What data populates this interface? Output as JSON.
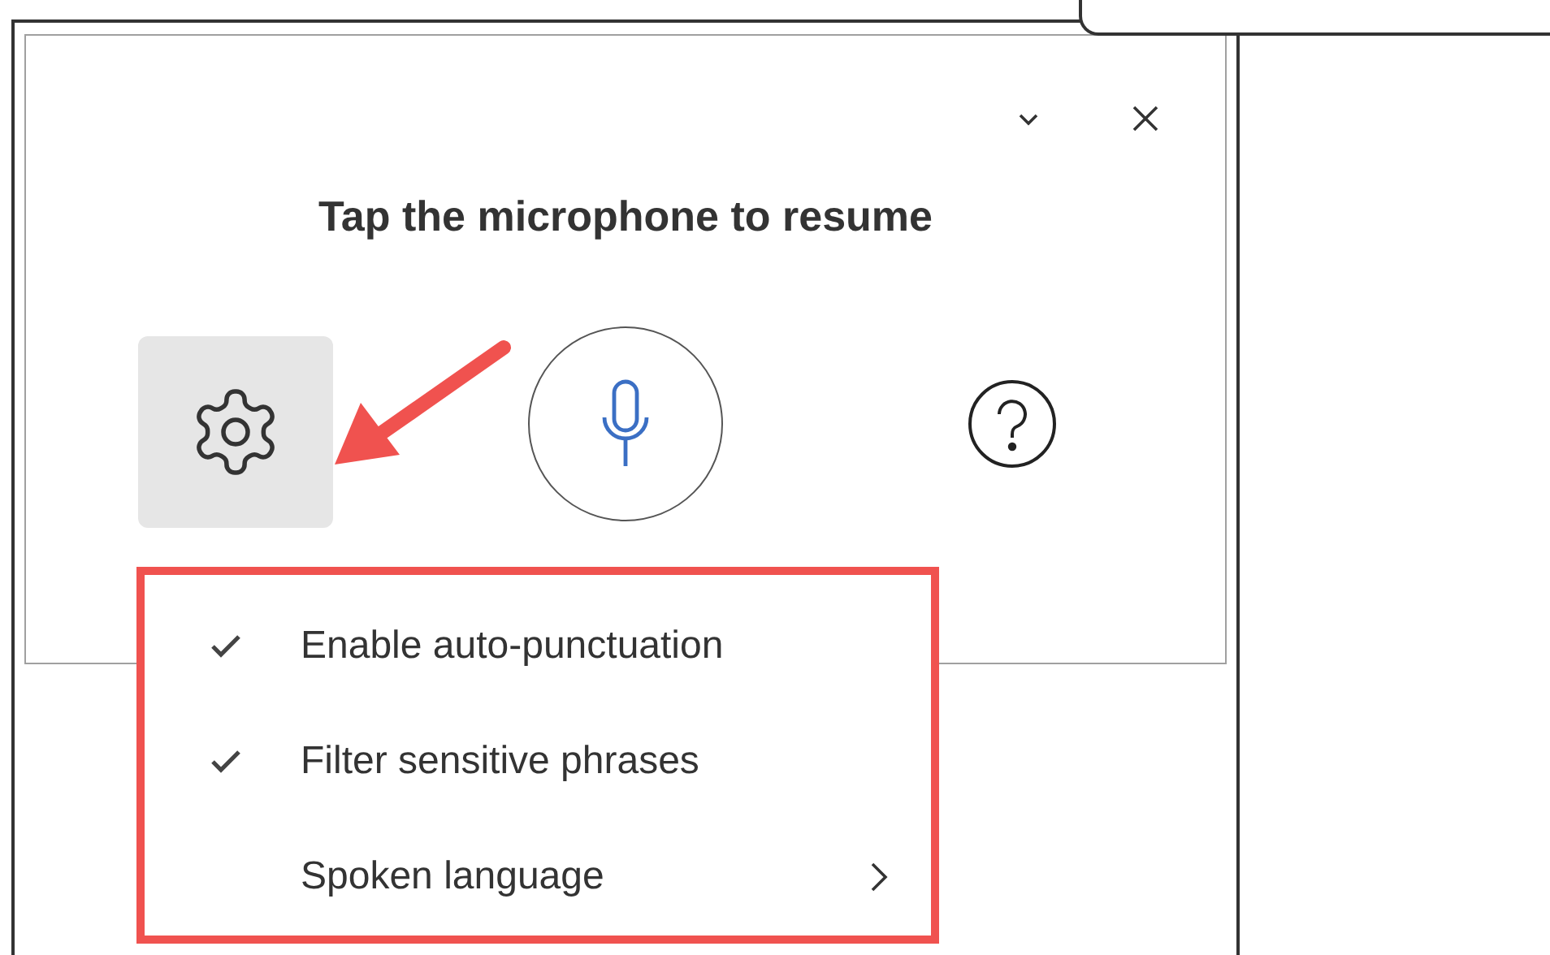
{
  "dictation_panel": {
    "title": "Tap the microphone to resume",
    "settings_button": {
      "active": true
    }
  },
  "settings_menu": {
    "items": [
      {
        "label": "Enable auto-punctuation",
        "kind": "toggle",
        "checked": true
      },
      {
        "label": "Filter sensitive phrases",
        "kind": "toggle",
        "checked": true
      },
      {
        "label": "Spoken language",
        "kind": "submenu",
        "checked": false
      }
    ]
  }
}
